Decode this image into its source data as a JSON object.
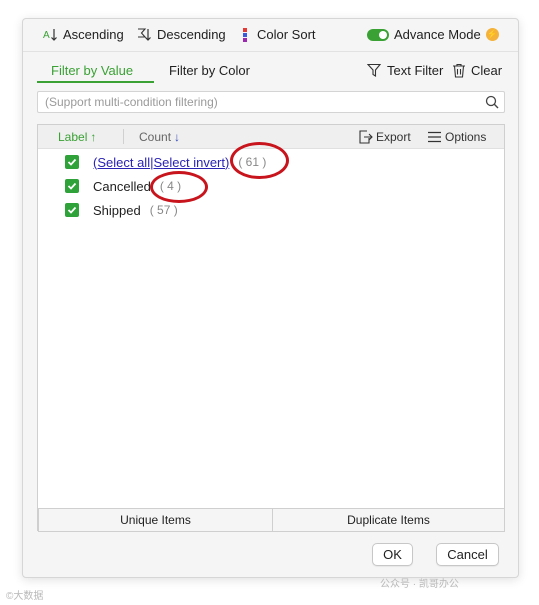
{
  "toolbar": {
    "ascending": "Ascending",
    "descending": "Descending",
    "color_sort": "Color Sort",
    "advance_mode": "Advance Mode"
  },
  "tabs": {
    "filter_by_value": "Filter by Value",
    "filter_by_color": "Filter by Color",
    "text_filter": "Text Filter",
    "clear": "Clear"
  },
  "search": {
    "placeholder": "(Support multi-condition filtering)"
  },
  "list": {
    "header": {
      "label": "Label",
      "count": "Count",
      "export": "Export",
      "options": "Options"
    },
    "select_all": "(Select all",
    "select_divider": "|",
    "select_invert": "Select invert)",
    "select_count": "( 61 )",
    "items": [
      {
        "label": "Cancelled",
        "count": "( 4 )",
        "checked": true
      },
      {
        "label": "Shipped",
        "count": "( 57 )",
        "checked": true
      }
    ]
  },
  "bottom": {
    "unique": "Unique Items",
    "duplicate": "Duplicate Items"
  },
  "buttons": {
    "ok": "OK",
    "cancel": "Cancel"
  },
  "colors": {
    "accent_green": "#3aa135",
    "checkbox_green": "#2fa33a",
    "link": "#2a23b3",
    "highlight_ring": "#c8141c"
  },
  "watermark": {
    "left": "©大数据",
    "right": "公众号 · 凯哥办公"
  }
}
